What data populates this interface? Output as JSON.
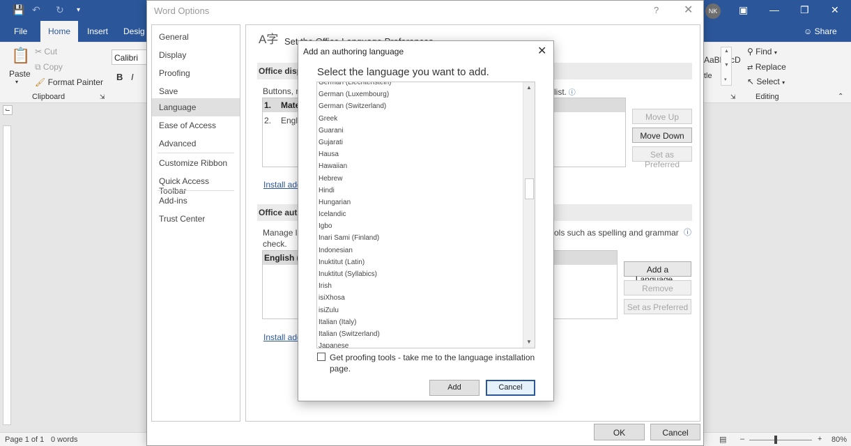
{
  "word": {
    "tabs": {
      "file": "File",
      "home": "Home",
      "insert": "Insert",
      "design": "Desig",
      "share": "Share"
    },
    "user_initials": "NK",
    "ribbon": {
      "paste": "Paste",
      "cut": "Cut",
      "copy": "Copy",
      "format_painter": "Format Painter",
      "clipboard": "Clipboard",
      "font_name": "Calibri (Bo",
      "bold": "B",
      "italic": "I",
      "style_preview": "AaBbCcD",
      "style_name": "tle",
      "find": "Find",
      "replace": "Replace",
      "select": "Select",
      "editing": "Editing"
    },
    "status": {
      "page": "Page 1 of 1",
      "words": "0 words",
      "zoom": "80%",
      "zoom_minus": "–",
      "zoom_plus": "+"
    }
  },
  "options": {
    "title": "Word Options",
    "help": "?",
    "close": "✕",
    "nav": [
      "General",
      "Display",
      "Proofing",
      "Save",
      "Language",
      "Ease of Access",
      "Advanced",
      "Customize Ribbon",
      "Quick Access Toolbar",
      "Add-ins",
      "Trust Center"
    ],
    "selected": "Language",
    "header": "Set the Office Language Preferences",
    "display_section": "Office disp",
    "display_desc": "Buttons, n",
    "display_desc_end": "list.",
    "display_list": [
      {
        "num": "1.",
        "label": "Mate"
      },
      {
        "num": "2.",
        "label": "Engli"
      }
    ],
    "move_up": "Move Up",
    "move_down": "Move Down",
    "set_preferred": "Set as Preferred",
    "install_display": "Install add",
    "authoring_section": "Office auth",
    "authoring_desc_left": "Manage la",
    "authoring_desc_right": "ols such as spelling and grammar",
    "authoring_desc_line2": "check.",
    "authoring_list_item": "English (U",
    "add_language": "Add a Language...",
    "remove": "Remove",
    "set_preferred_2": "Set as Preferred",
    "install_authoring": "Install add",
    "ok": "OK",
    "cancel": "Cancel"
  },
  "add_dialog": {
    "title": "Add an authoring language",
    "close": "✕",
    "heading": "Select the language you want to add.",
    "languages": [
      "German (Liechtenstein)",
      "German (Luxembourg)",
      "German (Switzerland)",
      "Greek",
      "Guarani",
      "Gujarati",
      "Hausa",
      "Hawaiian",
      "Hebrew",
      "Hindi",
      "Hungarian",
      "Icelandic",
      "Igbo",
      "Inari Sami (Finland)",
      "Indonesian",
      "Inuktitut (Latin)",
      "Inuktitut (Syllabics)",
      "Irish",
      "isiXhosa",
      "isiZulu",
      "Italian (Italy)",
      "Italian (Switzerland)",
      "Japanese"
    ],
    "checkbox_label": "Get proofing tools - take me to the language installation page.",
    "checkbox_checked": false,
    "add": "Add",
    "cancel": "Cancel"
  }
}
